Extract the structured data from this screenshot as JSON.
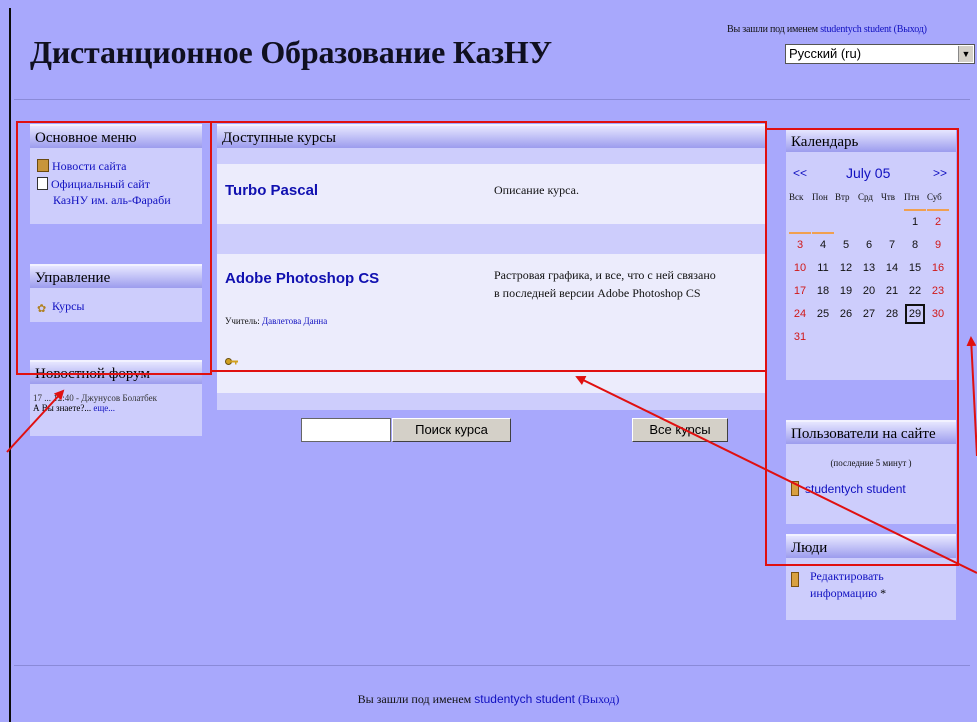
{
  "header": {
    "site_title": "Дистанционное Образование КазНУ",
    "login_prefix": "Вы зашли под именем",
    "user_name": "studentych student",
    "logout": "(Выход)",
    "language": "Русский (ru)"
  },
  "left": {
    "main_menu": {
      "title": "Основное меню",
      "items": [
        {
          "label": "Новости сайта",
          "icon": "book-icon"
        },
        {
          "label": "Официальный сайт",
          "label2": "КазНУ им. аль-Фараби",
          "icon": "document-icon"
        }
      ]
    },
    "admin": {
      "title": "Управление",
      "items": [
        {
          "label": "Курсы",
          "icon": "courses-icon"
        }
      ]
    },
    "news_forum": {
      "title": "Новостной форум",
      "post_meta": "17 ... 12:40 - Джунусов Болатбек",
      "post_text": "А Вы знаете?...",
      "post_more": "еще..."
    }
  },
  "center": {
    "title": "Доступные курсы",
    "courses": [
      {
        "name": "Turbo Pascal",
        "description": "Описание курса."
      },
      {
        "name": "Adobe Photoshop CS",
        "description_line1": "Растровая графика, и все, что с ней связано",
        "description_line2": "в последней версии  Adobe Photoshop CS",
        "teacher_label": "Учитель:",
        "teacher_name": "Давлетова Данна"
      }
    ],
    "search_button": "Поиск курса",
    "all_courses_button": "Все курсы"
  },
  "right": {
    "calendar": {
      "title": "Календарь",
      "prev": "<<",
      "month": "July 05",
      "next": ">>",
      "weekdays": [
        "Вск",
        "Пон",
        "Втр",
        "Срд",
        "Чтв",
        "Птн",
        "Суб"
      ],
      "weeks": [
        [
          "",
          "",
          "",
          "",
          "",
          "1",
          "2"
        ],
        [
          "3",
          "4",
          "5",
          "6",
          "7",
          "8",
          "9"
        ],
        [
          "10",
          "11",
          "12",
          "13",
          "14",
          "15",
          "16"
        ],
        [
          "17",
          "18",
          "19",
          "20",
          "21",
          "22",
          "23"
        ],
        [
          "24",
          "25",
          "26",
          "27",
          "28",
          "29",
          "30"
        ],
        [
          "31",
          "",
          "",
          "",
          "",
          "",
          ""
        ]
      ],
      "today": "29",
      "event_days": [
        "1",
        "2",
        "3",
        "4"
      ]
    },
    "online_users": {
      "title": "Пользователи на сайте",
      "subtitle": "(последние 5 минут )",
      "users": [
        "studentych student"
      ]
    },
    "people": {
      "title": "Люди",
      "edit_label_line1": "Редактировать",
      "edit_label_line2": "информацию",
      "edit_suffix": "*"
    }
  },
  "footer": {
    "prefix": "Вы зашли под именем",
    "user_name": "studentych student",
    "logout": "(Выход)"
  },
  "colors": {
    "page_bg": "#a8a8fc",
    "panel_bg": "#cdcdfc",
    "link": "#1010c0",
    "weekend": "#d01818",
    "annotation": "#e01010"
  }
}
